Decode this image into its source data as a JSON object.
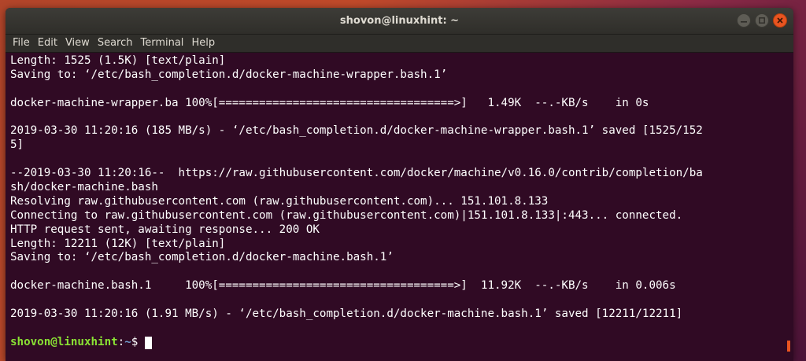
{
  "window": {
    "title": "shovon@linuxhint: ~"
  },
  "menu": [
    "File",
    "Edit",
    "View",
    "Search",
    "Terminal",
    "Help"
  ],
  "terminal": {
    "lines": [
      "Length: 1525 (1.5K) [text/plain]",
      "Saving to: ‘/etc/bash_completion.d/docker-machine-wrapper.bash.1’",
      "",
      "docker-machine-wrapper.ba 100%[===================================>]   1.49K  --.-KB/s    in 0s",
      "",
      "2019-03-30 11:20:16 (185 MB/s) - ‘/etc/bash_completion.d/docker-machine-wrapper.bash.1’ saved [1525/152",
      "5]",
      "",
      "--2019-03-30 11:20:16--  https://raw.githubusercontent.com/docker/machine/v0.16.0/contrib/completion/ba",
      "sh/docker-machine.bash",
      "Resolving raw.githubusercontent.com (raw.githubusercontent.com)... 151.101.8.133",
      "Connecting to raw.githubusercontent.com (raw.githubusercontent.com)|151.101.8.133|:443... connected.",
      "HTTP request sent, awaiting response... 200 OK",
      "Length: 12211 (12K) [text/plain]",
      "Saving to: ‘/etc/bash_completion.d/docker-machine.bash.1’",
      "",
      "docker-machine.bash.1     100%[===================================>]  11.92K  --.-KB/s    in 0.006s",
      "",
      "2019-03-30 11:20:16 (1.91 MB/s) - ‘/etc/bash_completion.d/docker-machine.bash.1’ saved [12211/12211]",
      ""
    ],
    "prompt": {
      "user_host": "shovon@linuxhint",
      "separator": ":",
      "path": "~",
      "symbol": "$"
    }
  },
  "colors": {
    "terminal_bg": "#300a24",
    "prompt_user": "#8ae234",
    "prompt_path": "#729fcf",
    "accent": "#e95420"
  }
}
